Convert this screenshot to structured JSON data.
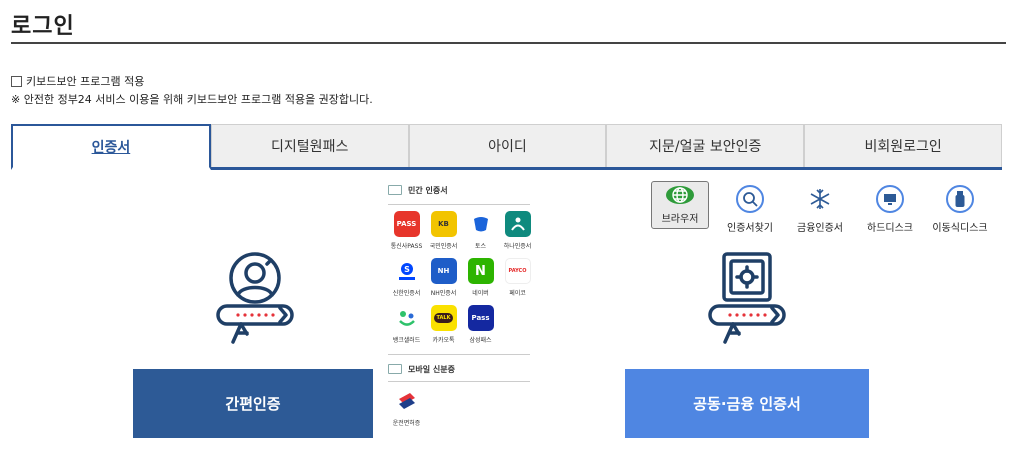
{
  "page": {
    "title": "로그인"
  },
  "keyboard_security": {
    "checkbox_label": "키보드보안 프로그램 적용",
    "notice": "※ 안전한 정부24 서비스 이용을 위해 키보드보안 프로그램 적용을 권장합니다."
  },
  "tabs": [
    {
      "label": "인증서",
      "active": true
    },
    {
      "label": "디지털원패스",
      "active": false
    },
    {
      "label": "아이디",
      "active": false
    },
    {
      "label": "지문/얼굴 보안인증",
      "active": false
    },
    {
      "label": "비회원로그인",
      "active": false
    }
  ],
  "simple_auth": {
    "button_label": "간편인증"
  },
  "joint_auth": {
    "button_label": "공동·금융 인증서"
  },
  "private_certs": {
    "heading": "민간 인증서",
    "providers": [
      {
        "name": "통신사PASS",
        "logo_text": "PASS",
        "color": "#e7352b"
      },
      {
        "name": "국민인증서",
        "logo_text": "KB",
        "color": "#f2c400"
      },
      {
        "name": "토스",
        "logo_text": "",
        "color": "#ffffff"
      },
      {
        "name": "하나인증서",
        "logo_text": "",
        "color": "#0f8a7e"
      },
      {
        "name": "신한인증서",
        "logo_text": "S",
        "color": "#ffffff"
      },
      {
        "name": "NH인증서",
        "logo_text": "NH",
        "color": "#1e5dc8"
      },
      {
        "name": "네이버",
        "logo_text": "N",
        "color": "#2db400"
      },
      {
        "name": "페이코",
        "logo_text": "PAYCO",
        "color": "#ffffff"
      },
      {
        "name": "뱅크샐러드",
        "logo_text": "",
        "color": "#ffffff"
      },
      {
        "name": "카카오톡",
        "logo_text": "TALK",
        "color": "#fae100"
      },
      {
        "name": "삼성패스",
        "logo_text": "Pass",
        "color": "#1428a0"
      }
    ]
  },
  "mobile_id": {
    "heading": "모바일 신분증",
    "items": [
      {
        "name": "운전면허증"
      }
    ]
  },
  "cert_media": [
    {
      "label": "브라우저",
      "selected": true
    },
    {
      "label": "인증서찾기",
      "selected": false
    },
    {
      "label": "금융인증서",
      "selected": false
    },
    {
      "label": "하드디스크",
      "selected": false
    },
    {
      "label": "이동식디스크",
      "selected": false
    }
  ]
}
